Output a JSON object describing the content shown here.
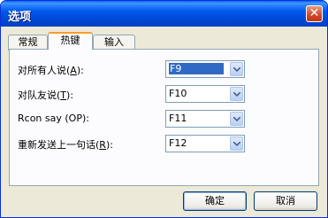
{
  "window": {
    "title": "选项"
  },
  "tabs": [
    {
      "label": "常规"
    },
    {
      "label": "热键"
    },
    {
      "label": "输入"
    }
  ],
  "rows": [
    {
      "label_pre": "对所有人说(",
      "mnemonic": "A",
      "label_post": "):",
      "value": "F9"
    },
    {
      "label_pre": "对队友说(",
      "mnemonic": "T",
      "label_post": "):",
      "value": "F10"
    },
    {
      "label_pre": "Rcon say (OP):",
      "mnemonic": "",
      "label_post": "",
      "value": "F11"
    },
    {
      "label_pre": "重新发送上一句话(",
      "mnemonic": "R",
      "label_post": "):",
      "value": "F12"
    }
  ],
  "buttons": {
    "ok": "确定",
    "cancel": "取消"
  },
  "colors": {
    "titlebar": "#0058ee",
    "tab_highlight": "#ff9d27",
    "selection": "#316ac5"
  }
}
